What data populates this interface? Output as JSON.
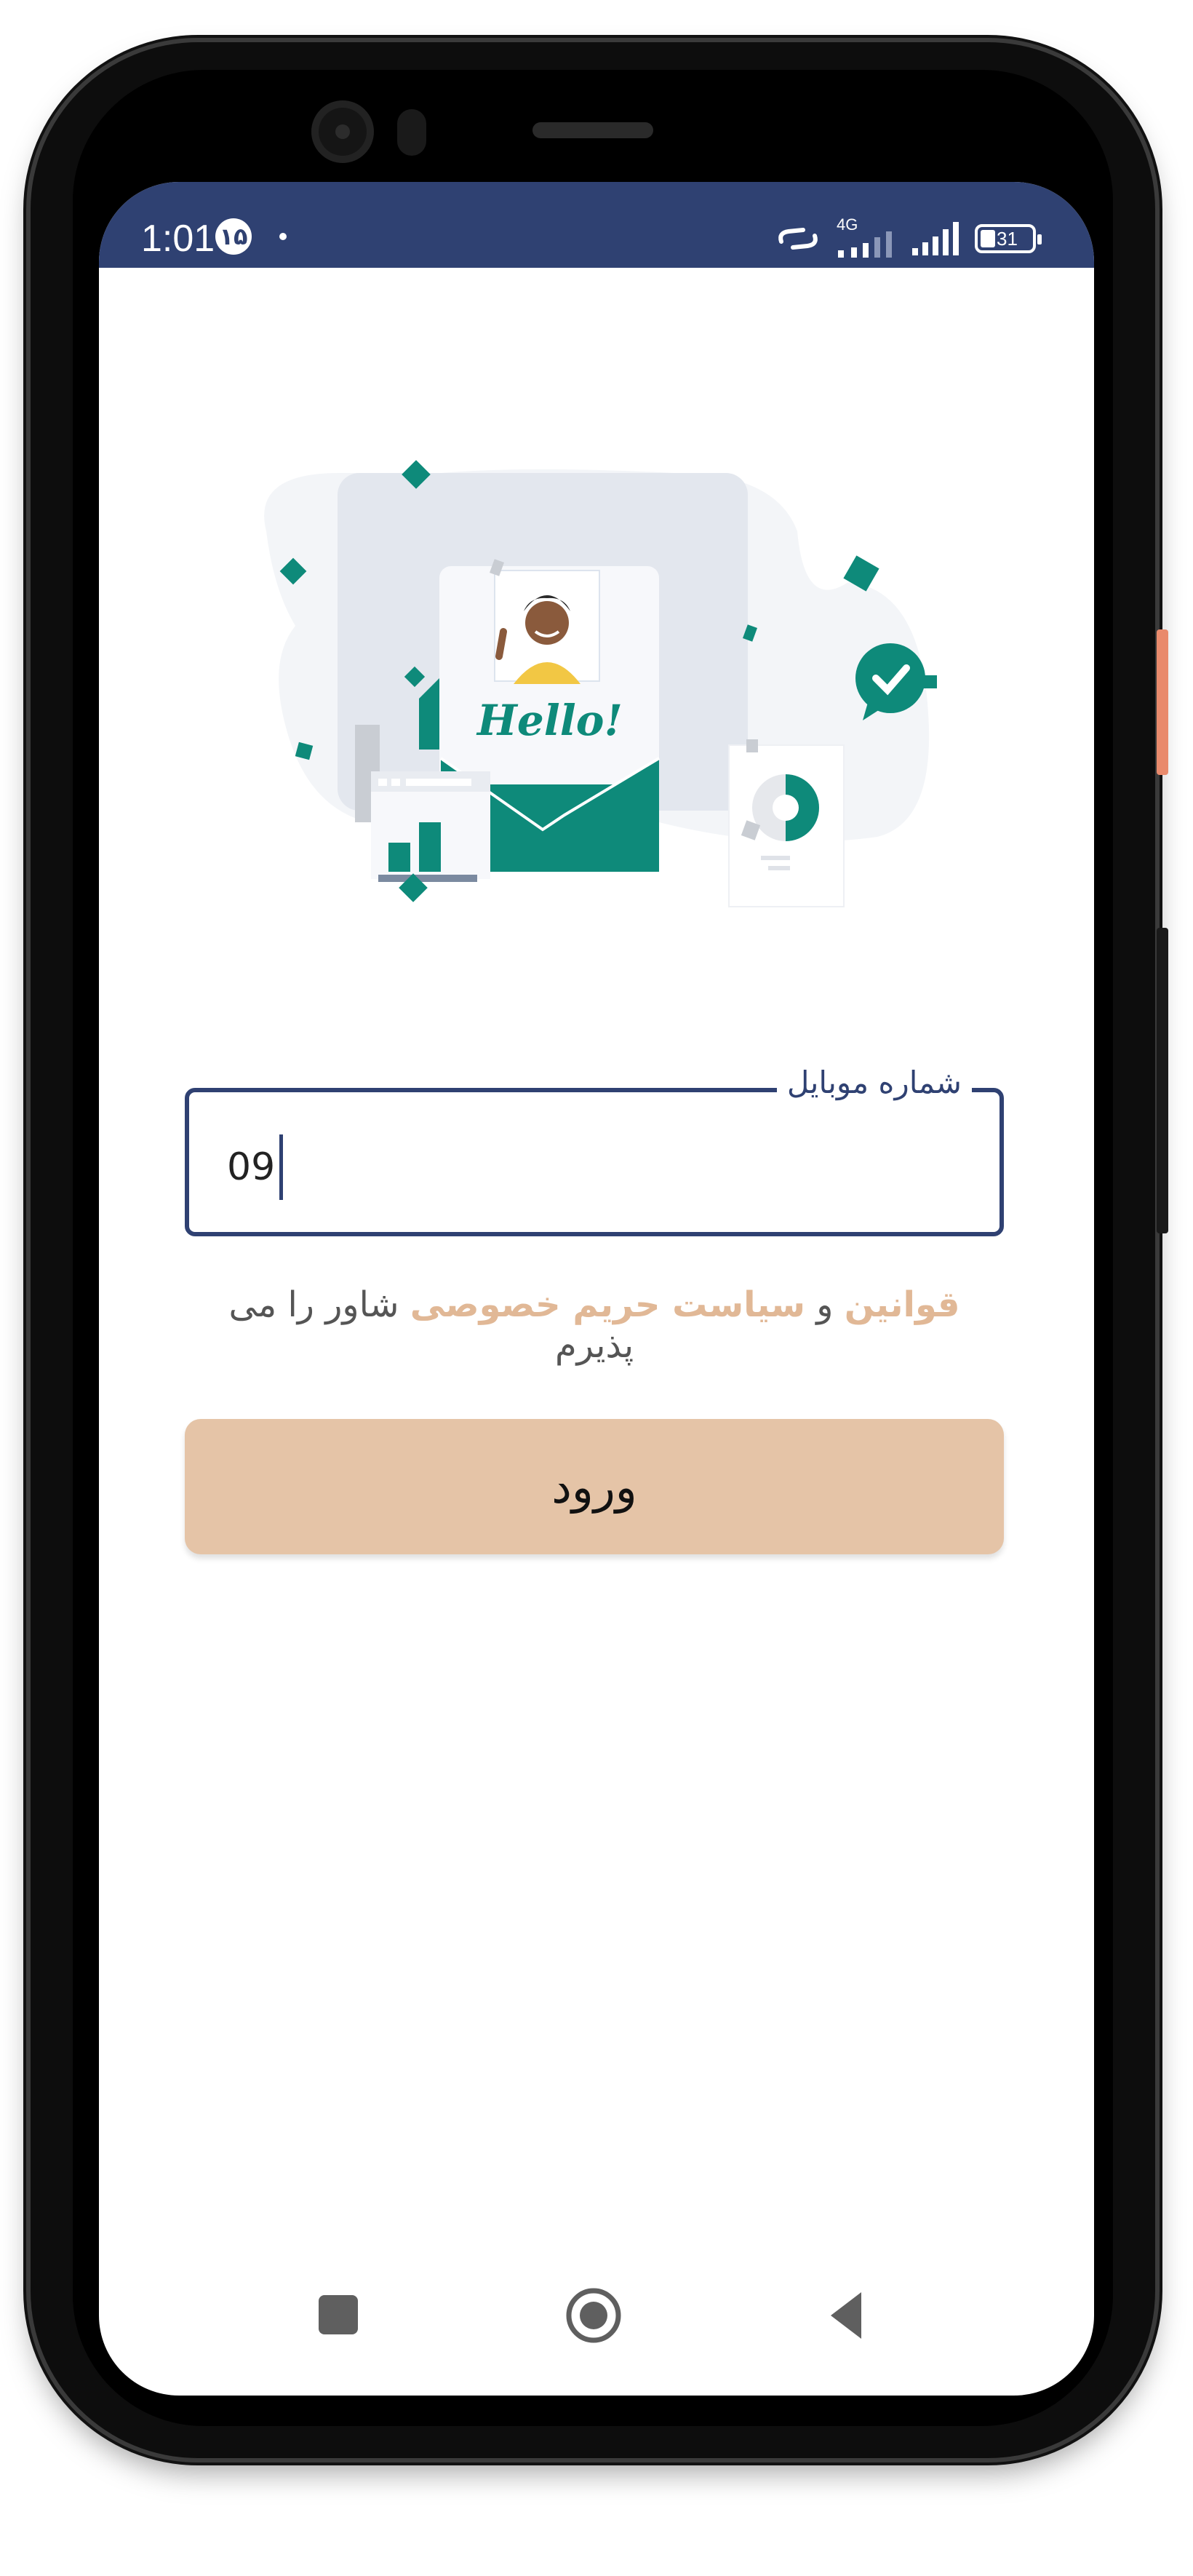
{
  "status_bar": {
    "time": "1:01",
    "badge": "۱۵",
    "network": "4G",
    "battery": "31"
  },
  "illustration": {
    "hello_text": "Hello!"
  },
  "mobile_field": {
    "label": "شماره موبایل",
    "value": "09"
  },
  "terms": {
    "link_rules": "قوانین",
    "connector": "و",
    "link_privacy": "سیاست حریم خصوصی",
    "suffix": "شاور را می پذیرم"
  },
  "login_button": {
    "label": "ورود"
  },
  "colors": {
    "primary": "#2f4172",
    "accent": "#e5c4a7",
    "link": "#e1b896",
    "teal": "#0e8a7a"
  },
  "navigation": {
    "icons": [
      "recents-square-icon",
      "home-circle-icon",
      "back-triangle-icon"
    ]
  }
}
